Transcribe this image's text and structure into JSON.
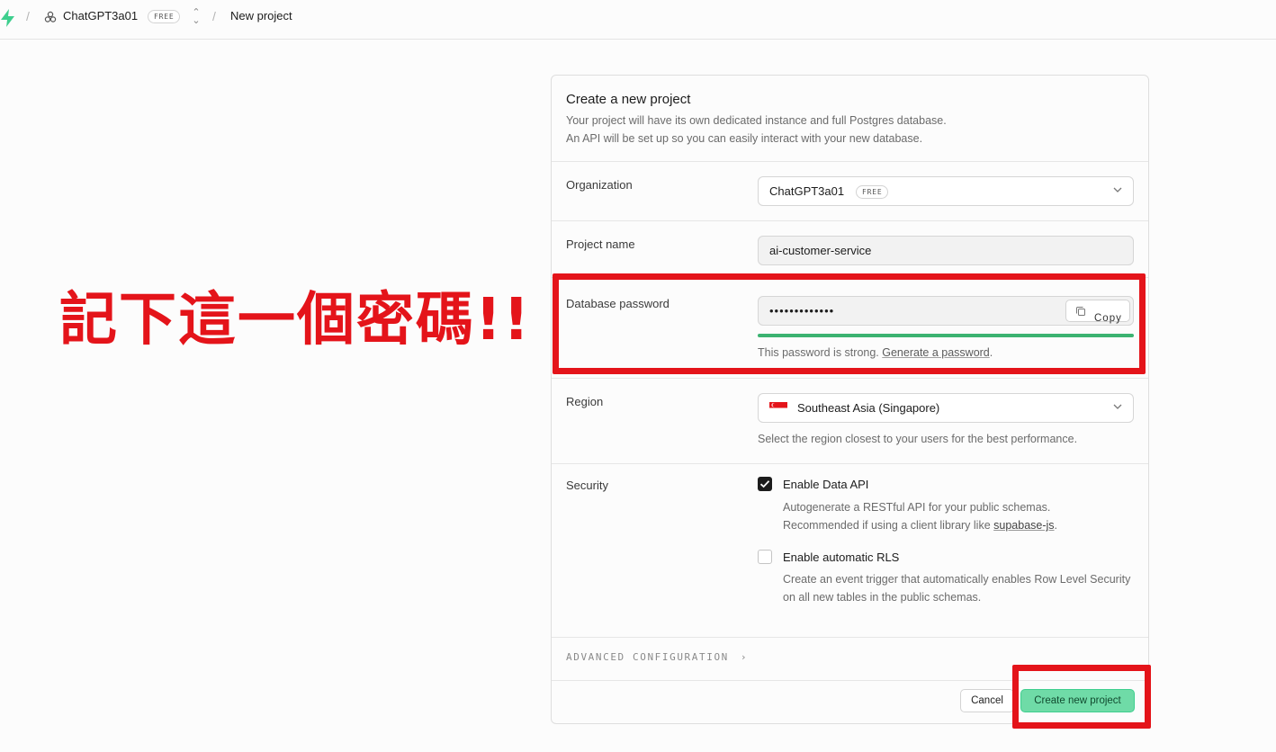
{
  "topbar": {
    "org_name": "ChatGPT3a01",
    "org_badge": "FREE",
    "page": "New project",
    "separator": "/"
  },
  "annotation": {
    "text": "記下這一個密碼!!",
    "color": "#e4141a"
  },
  "form": {
    "title": "Create a new project",
    "desc_line1": "Your project will have its own dedicated instance and full Postgres database.",
    "desc_line2": "An API will be set up so you can easily interact with your new database.",
    "organization": {
      "label": "Organization",
      "value": "ChatGPT3a01",
      "badge": "FREE"
    },
    "project_name": {
      "label": "Project name",
      "value": "ai-customer-service"
    },
    "database_password": {
      "label": "Database password",
      "value": "•••••••••••••",
      "copy_label": "Copy",
      "help_prefix": "This password is strong. ",
      "help_link": "Generate a password",
      "help_suffix": "."
    },
    "region": {
      "label": "Region",
      "value": "Southeast Asia (Singapore)",
      "help": "Select the region closest to your users for the best performance."
    },
    "security": {
      "label": "Security",
      "data_api": {
        "title": "Enable Data API",
        "checked": true,
        "desc_line1": "Autogenerate a RESTful API for your public schemas.",
        "desc_line2_prefix": "Recommended if using a client library like ",
        "desc_link": "supabase-js",
        "desc_line2_suffix": "."
      },
      "auto_rls": {
        "title": "Enable automatic RLS",
        "checked": false,
        "desc": "Create an event trigger that automatically enables Row Level Security on all new tables in the public schemas."
      }
    },
    "advanced_label": "ADVANCED CONFIGURATION",
    "cancel_label": "Cancel",
    "create_label": "Create new project"
  },
  "colors": {
    "brand_green": "#3ecf8e",
    "create_button_bg": "#6fdba7",
    "annotation_red": "#e4141a",
    "strength_bar": "#3cb371"
  }
}
